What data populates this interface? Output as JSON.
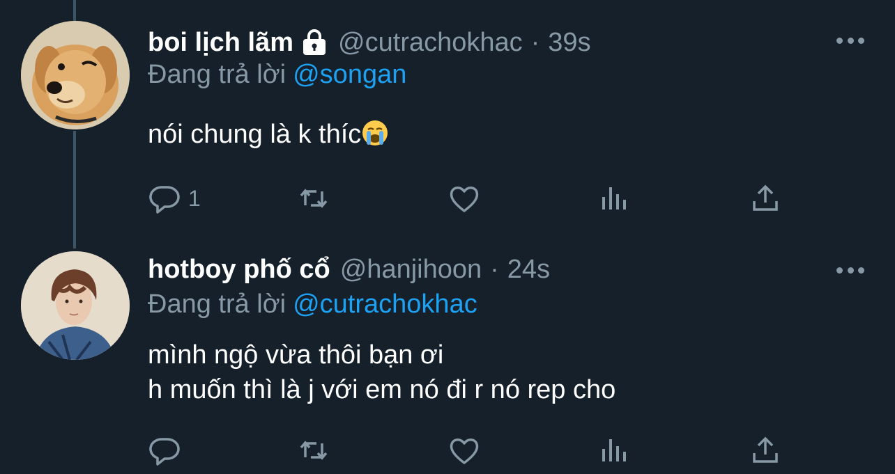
{
  "tweets": [
    {
      "name": "boi lịch lãm",
      "handle": "@cutrachokhac",
      "separator": "·",
      "time": "39s",
      "reply_prefix": "Đang trả lời",
      "reply_to": "@songan",
      "text_lines": [
        "nói chung là k thíc"
      ],
      "reply_count": "1",
      "avatar_icon": "dog-avatar",
      "protected": true
    },
    {
      "name": "hotboy phố cổ",
      "handle": "@hanjihoon",
      "separator": "·",
      "time": "24s",
      "reply_prefix": "Đang trả lời",
      "reply_to": "@cutrachokhac",
      "text_lines": [
        "mình ngộ vừa thôi bạn ơi",
        "h muốn thì là j với em nó đi r nó rep cho"
      ],
      "reply_count": "",
      "avatar_icon": "person-avatar",
      "protected": false
    }
  ],
  "colors": {
    "background": "#15202b",
    "primary_text": "#ffffff",
    "secondary_text": "#8899a6",
    "link": "#1da1f2",
    "thread_line": "#3d5466"
  },
  "icons": [
    "reply-icon",
    "retweet-icon",
    "like-icon",
    "stats-icon",
    "share-icon",
    "more-icon",
    "lock-icon",
    "crying-emoji-icon"
  ]
}
